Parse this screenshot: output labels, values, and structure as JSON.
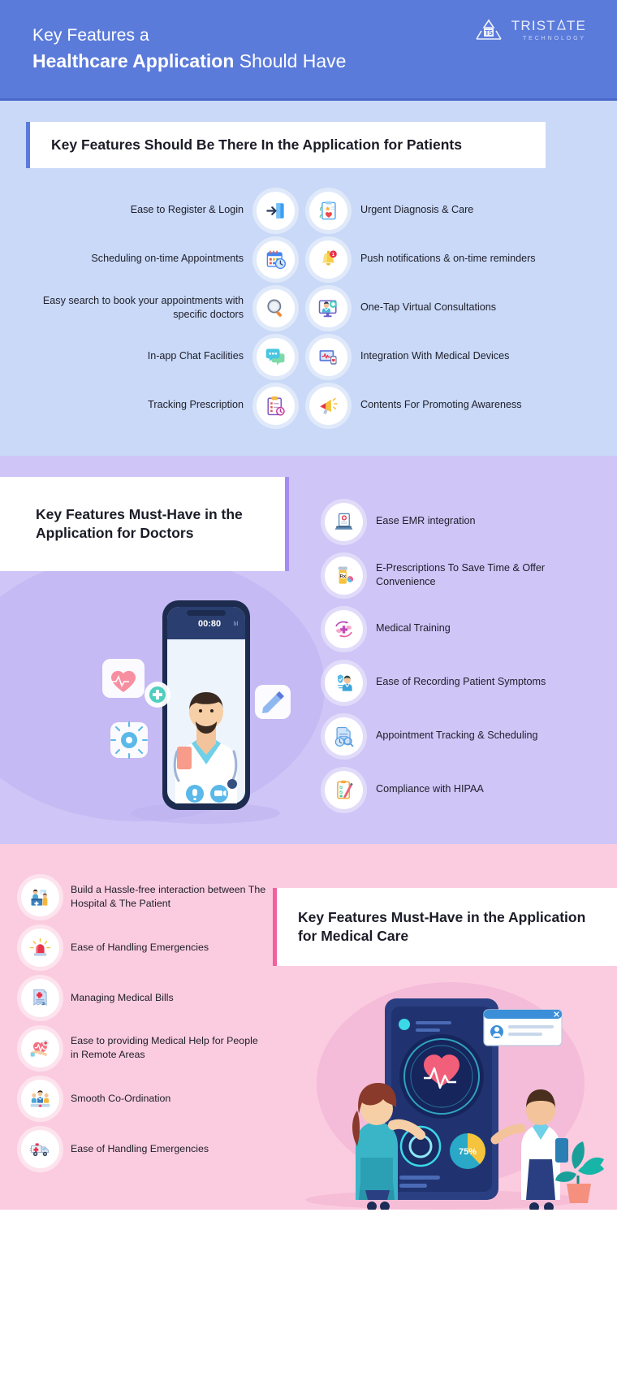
{
  "header": {
    "line1": "Key Features a",
    "line2_bold": "Healthcare Application",
    "line2_rest": " Should Have",
    "logo_name_part1": "TRIST",
    "logo_name_part2": "TE",
    "logo_sub": "TECHNOLOGY",
    "logo_badge": "T5",
    "bg_color": "#5b7bdb"
  },
  "patients": {
    "heading": "Key Features Should Be There In the Application for Patients",
    "accent_color": "#5b7bdb",
    "bg_color": "#c9d9f7",
    "left_items": [
      {
        "label": "Ease to Register & Login",
        "icon": "login-door-icon"
      },
      {
        "label": "Scheduling on-time Appointments",
        "icon": "calendar-clock-icon"
      },
      {
        "label": "Easy search to book your appointments with specific doctors",
        "icon": "magnifier-icon"
      },
      {
        "label": "In-app Chat Facilities",
        "icon": "chat-bubbles-icon"
      },
      {
        "label": "Tracking Prescription",
        "icon": "prescription-clipboard-icon"
      }
    ],
    "right_items": [
      {
        "label": "Urgent Diagnosis & Care",
        "icon": "medical-chart-heart-icon"
      },
      {
        "label": "Push notifications & on-time reminders",
        "icon": "bell-notification-icon"
      },
      {
        "label": "One-Tap Virtual Consultations",
        "icon": "video-doctor-monitor-icon"
      },
      {
        "label": "Integration With Medical Devices",
        "icon": "monitor-smartwatch-icon"
      },
      {
        "label": "Contents For Promoting Awareness",
        "icon": "megaphone-icon"
      }
    ]
  },
  "doctors": {
    "heading": "Key Features Must-Have in the Application for Doctors",
    "accent_color": "#a48df0",
    "bg_color": "#cfc5f7",
    "phone_time": "00:80",
    "items": [
      {
        "label": "Ease EMR integration",
        "icon": "laptop-medical-record-icon"
      },
      {
        "label": "E-Prescriptions To Save Time & Offer Convenience",
        "icon": "pill-bottle-rx-icon"
      },
      {
        "label": "Medical Training",
        "icon": "hands-medical-cross-icon"
      },
      {
        "label": "Ease of Recording Patient Symptoms",
        "icon": "patient-profile-icon"
      },
      {
        "label": "Appointment Tracking & Scheduling",
        "icon": "document-clock-search-icon"
      },
      {
        "label": "Compliance with HIPAA",
        "icon": "checklist-pen-icon"
      }
    ]
  },
  "care": {
    "heading": "Key Features Must-Have in the Application for Medical Care",
    "accent_color": "#f35fa0",
    "bg_color": "#fbccdf",
    "gauge_label": "75%",
    "items": [
      {
        "label": "Build a Hassle-free interaction between The Hospital & The Patient",
        "icon": "reception-desk-icon"
      },
      {
        "label": "Ease of Handling Emergencies",
        "icon": "emergency-siren-icon"
      },
      {
        "label": "Managing Medical Bills",
        "icon": "medical-invoice-icon"
      },
      {
        "label": "Ease to providing Medical Help for People in Remote Areas",
        "icon": "hand-heart-icon"
      },
      {
        "label": "Smooth Co-Ordination",
        "icon": "team-group-icon"
      },
      {
        "label": "Ease of Handling Emergencies",
        "icon": "ambulance-icon"
      }
    ]
  }
}
